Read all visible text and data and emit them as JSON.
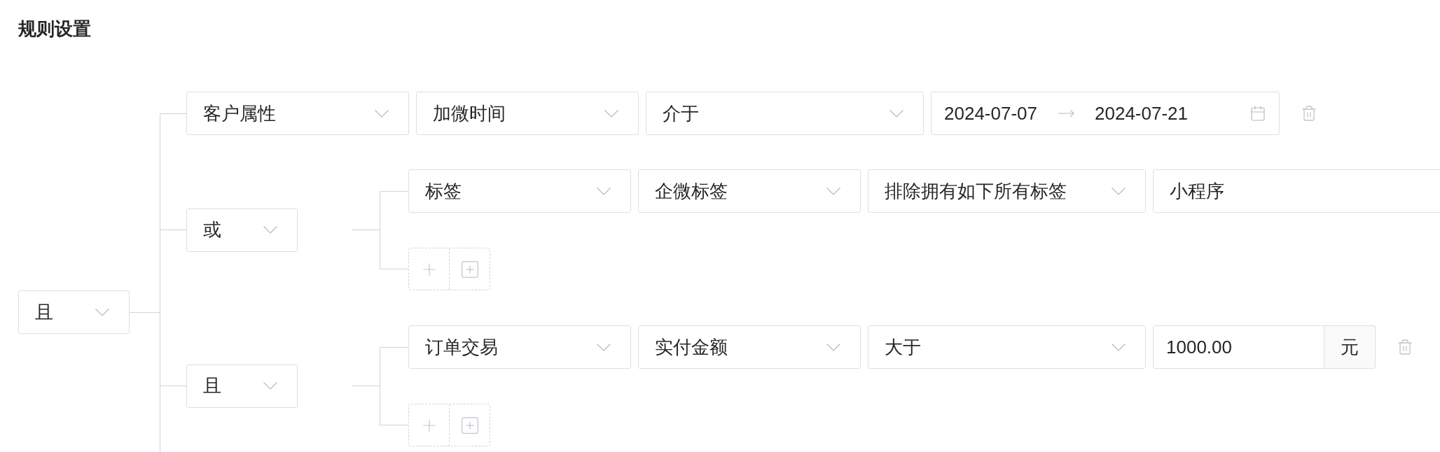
{
  "title": "规则设置",
  "root": {
    "operator": "且",
    "children": [
      {
        "kind": "condition",
        "fields": [
          "客户属性",
          "加微时间",
          "介于"
        ],
        "value": {
          "kind": "date_range",
          "start": "2024-07-07",
          "end": "2024-07-21"
        },
        "deletable": true
      },
      {
        "kind": "group",
        "operator": "或",
        "children": [
          {
            "kind": "condition",
            "fields": [
              "标签",
              "企微标签",
              "排除拥有如下所有标签"
            ],
            "value": {
              "kind": "tags",
              "text": "小程序"
            }
          }
        ]
      },
      {
        "kind": "group",
        "operator": "且",
        "children": [
          {
            "kind": "condition",
            "fields": [
              "订单交易",
              "实付金额",
              "大于"
            ],
            "value": {
              "kind": "amount",
              "amount": "1000.00",
              "unit": "元"
            },
            "deletable": true
          }
        ]
      }
    ]
  }
}
